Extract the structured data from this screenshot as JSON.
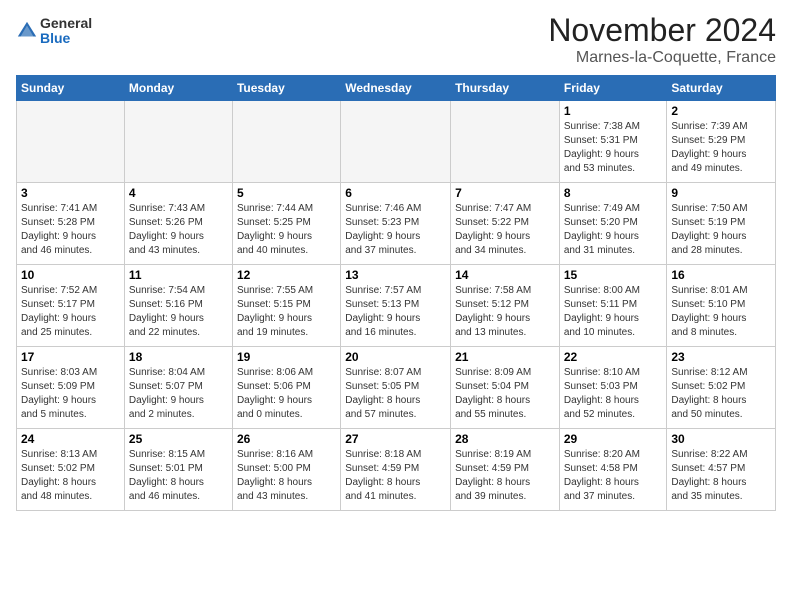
{
  "header": {
    "logo_general": "General",
    "logo_blue": "Blue",
    "month_title": "November 2024",
    "location": "Marnes-la-Coquette, France"
  },
  "weekdays": [
    "Sunday",
    "Monday",
    "Tuesday",
    "Wednesday",
    "Thursday",
    "Friday",
    "Saturday"
  ],
  "weeks": [
    [
      {
        "day": "",
        "info": ""
      },
      {
        "day": "",
        "info": ""
      },
      {
        "day": "",
        "info": ""
      },
      {
        "day": "",
        "info": ""
      },
      {
        "day": "",
        "info": ""
      },
      {
        "day": "1",
        "info": "Sunrise: 7:38 AM\nSunset: 5:31 PM\nDaylight: 9 hours\nand 53 minutes."
      },
      {
        "day": "2",
        "info": "Sunrise: 7:39 AM\nSunset: 5:29 PM\nDaylight: 9 hours\nand 49 minutes."
      }
    ],
    [
      {
        "day": "3",
        "info": "Sunrise: 7:41 AM\nSunset: 5:28 PM\nDaylight: 9 hours\nand 46 minutes."
      },
      {
        "day": "4",
        "info": "Sunrise: 7:43 AM\nSunset: 5:26 PM\nDaylight: 9 hours\nand 43 minutes."
      },
      {
        "day": "5",
        "info": "Sunrise: 7:44 AM\nSunset: 5:25 PM\nDaylight: 9 hours\nand 40 minutes."
      },
      {
        "day": "6",
        "info": "Sunrise: 7:46 AM\nSunset: 5:23 PM\nDaylight: 9 hours\nand 37 minutes."
      },
      {
        "day": "7",
        "info": "Sunrise: 7:47 AM\nSunset: 5:22 PM\nDaylight: 9 hours\nand 34 minutes."
      },
      {
        "day": "8",
        "info": "Sunrise: 7:49 AM\nSunset: 5:20 PM\nDaylight: 9 hours\nand 31 minutes."
      },
      {
        "day": "9",
        "info": "Sunrise: 7:50 AM\nSunset: 5:19 PM\nDaylight: 9 hours\nand 28 minutes."
      }
    ],
    [
      {
        "day": "10",
        "info": "Sunrise: 7:52 AM\nSunset: 5:17 PM\nDaylight: 9 hours\nand 25 minutes."
      },
      {
        "day": "11",
        "info": "Sunrise: 7:54 AM\nSunset: 5:16 PM\nDaylight: 9 hours\nand 22 minutes."
      },
      {
        "day": "12",
        "info": "Sunrise: 7:55 AM\nSunset: 5:15 PM\nDaylight: 9 hours\nand 19 minutes."
      },
      {
        "day": "13",
        "info": "Sunrise: 7:57 AM\nSunset: 5:13 PM\nDaylight: 9 hours\nand 16 minutes."
      },
      {
        "day": "14",
        "info": "Sunrise: 7:58 AM\nSunset: 5:12 PM\nDaylight: 9 hours\nand 13 minutes."
      },
      {
        "day": "15",
        "info": "Sunrise: 8:00 AM\nSunset: 5:11 PM\nDaylight: 9 hours\nand 10 minutes."
      },
      {
        "day": "16",
        "info": "Sunrise: 8:01 AM\nSunset: 5:10 PM\nDaylight: 9 hours\nand 8 minutes."
      }
    ],
    [
      {
        "day": "17",
        "info": "Sunrise: 8:03 AM\nSunset: 5:09 PM\nDaylight: 9 hours\nand 5 minutes."
      },
      {
        "day": "18",
        "info": "Sunrise: 8:04 AM\nSunset: 5:07 PM\nDaylight: 9 hours\nand 2 minutes."
      },
      {
        "day": "19",
        "info": "Sunrise: 8:06 AM\nSunset: 5:06 PM\nDaylight: 9 hours\nand 0 minutes."
      },
      {
        "day": "20",
        "info": "Sunrise: 8:07 AM\nSunset: 5:05 PM\nDaylight: 8 hours\nand 57 minutes."
      },
      {
        "day": "21",
        "info": "Sunrise: 8:09 AM\nSunset: 5:04 PM\nDaylight: 8 hours\nand 55 minutes."
      },
      {
        "day": "22",
        "info": "Sunrise: 8:10 AM\nSunset: 5:03 PM\nDaylight: 8 hours\nand 52 minutes."
      },
      {
        "day": "23",
        "info": "Sunrise: 8:12 AM\nSunset: 5:02 PM\nDaylight: 8 hours\nand 50 minutes."
      }
    ],
    [
      {
        "day": "24",
        "info": "Sunrise: 8:13 AM\nSunset: 5:02 PM\nDaylight: 8 hours\nand 48 minutes."
      },
      {
        "day": "25",
        "info": "Sunrise: 8:15 AM\nSunset: 5:01 PM\nDaylight: 8 hours\nand 46 minutes."
      },
      {
        "day": "26",
        "info": "Sunrise: 8:16 AM\nSunset: 5:00 PM\nDaylight: 8 hours\nand 43 minutes."
      },
      {
        "day": "27",
        "info": "Sunrise: 8:18 AM\nSunset: 4:59 PM\nDaylight: 8 hours\nand 41 minutes."
      },
      {
        "day": "28",
        "info": "Sunrise: 8:19 AM\nSunset: 4:59 PM\nDaylight: 8 hours\nand 39 minutes."
      },
      {
        "day": "29",
        "info": "Sunrise: 8:20 AM\nSunset: 4:58 PM\nDaylight: 8 hours\nand 37 minutes."
      },
      {
        "day": "30",
        "info": "Sunrise: 8:22 AM\nSunset: 4:57 PM\nDaylight: 8 hours\nand 35 minutes."
      }
    ]
  ]
}
